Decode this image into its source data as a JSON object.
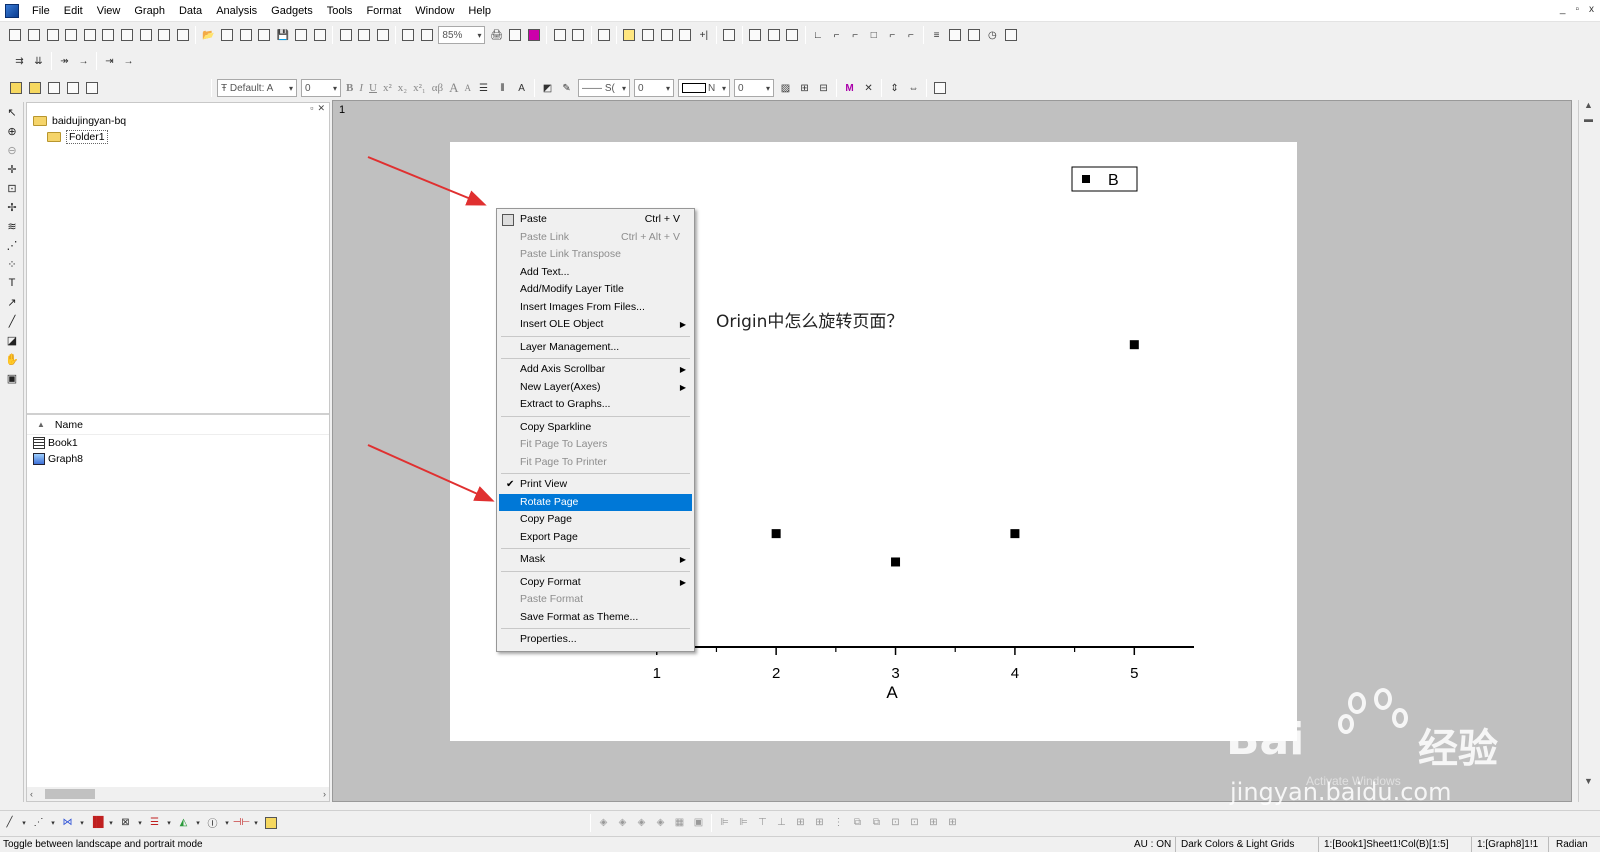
{
  "menubar": {
    "items": [
      "File",
      "Edit",
      "View",
      "Graph",
      "Data",
      "Analysis",
      "Gadgets",
      "Tools",
      "Format",
      "Window",
      "Help"
    ],
    "window_controls": [
      "_",
      "▫",
      "x"
    ]
  },
  "toolbar": {
    "zoom": "85%",
    "font": "Default: A",
    "font_size": "0",
    "format_buttons": [
      "B",
      "I",
      "U",
      "x²",
      "x₂",
      "x²₁",
      "αβ",
      "A",
      "A"
    ],
    "line_width_value": "0",
    "line_style_value": "S(",
    "fill_value": "N",
    "fill_size_value": "0"
  },
  "explorer": {
    "root_folder": "baidujingyan-bq",
    "subfolder": "Folder1",
    "list_header": "Name",
    "files": [
      {
        "name": "Book1",
        "icon": "workbook-icon"
      },
      {
        "name": "Graph8",
        "icon": "graph-icon"
      }
    ]
  },
  "workspace": {
    "layer_number": "1",
    "page_text": "Origin中怎么旋转页面？",
    "legend_label": "B"
  },
  "chart_data": {
    "type": "scatter",
    "xlabel": "A",
    "ylabel": "",
    "x_ticks": [
      "1",
      "2",
      "3",
      "4",
      "5"
    ],
    "xlim": [
      0.6,
      5.5
    ],
    "series": [
      {
        "name": "B",
        "x": [
          2,
          3,
          4,
          5
        ],
        "y": [
          3.0,
          2.7,
          3.0,
          5.0
        ]
      }
    ],
    "ylim": [
      1.8,
      5.6
    ],
    "legend": "top-right",
    "grid": false
  },
  "context_menu": {
    "items": [
      {
        "label": "Paste",
        "shortcut": "Ctrl + V",
        "disabled": false,
        "icon": "paste-icon"
      },
      {
        "label": "Paste Link",
        "shortcut": "Ctrl + Alt + V",
        "disabled": true
      },
      {
        "label": "Paste Link Transpose",
        "disabled": true
      },
      {
        "label": "Add Text...",
        "disabled": false
      },
      {
        "label": "Add/Modify Layer Title",
        "disabled": false
      },
      {
        "label": "Insert Images From Files...",
        "disabled": false
      },
      {
        "label": "Insert OLE Object",
        "disabled": false,
        "submenu": true
      },
      {
        "sep": true
      },
      {
        "label": "Layer Management...",
        "disabled": false
      },
      {
        "sep": true
      },
      {
        "label": "Add Axis Scrollbar",
        "disabled": false,
        "submenu": true
      },
      {
        "label": "New Layer(Axes)",
        "disabled": false,
        "submenu": true
      },
      {
        "label": "Extract to Graphs...",
        "disabled": false
      },
      {
        "sep": true
      },
      {
        "label": "Copy Sparkline",
        "disabled": false
      },
      {
        "label": "Fit Page To Layers",
        "disabled": true
      },
      {
        "label": "Fit Page To Printer",
        "disabled": true
      },
      {
        "sep": true
      },
      {
        "label": "Print View",
        "disabled": false,
        "checked": true
      },
      {
        "label": "Rotate Page",
        "disabled": false,
        "highlight": true
      },
      {
        "label": "Copy Page",
        "disabled": false
      },
      {
        "label": "Export Page",
        "disabled": false
      },
      {
        "sep": true
      },
      {
        "label": "Mask",
        "disabled": false,
        "submenu": true
      },
      {
        "sep": true
      },
      {
        "label": "Copy Format",
        "disabled": false,
        "submenu": true
      },
      {
        "label": "Paste Format",
        "disabled": true
      },
      {
        "label": "Save Format as Theme...",
        "disabled": false
      },
      {
        "sep": true
      },
      {
        "label": "Properties...",
        "disabled": false
      }
    ]
  },
  "status": {
    "message": "Toggle between landscape and portrait mode",
    "cells": [
      "AU : ON",
      "Dark Colors & Light Grids",
      "1:[Book1]Sheet1!Col(B)[1:5]",
      "1:[Graph8]1!1",
      "Radian"
    ]
  },
  "watermark": {
    "logo_text": "Bai",
    "logo_text_after": "经验",
    "url": "jingyan.baidu.com",
    "windows_notice": "Activate Windows"
  },
  "colors": {
    "highlight": "#0078d7",
    "arrow": "#e03030",
    "workspace_bg": "#c0c0c0"
  }
}
